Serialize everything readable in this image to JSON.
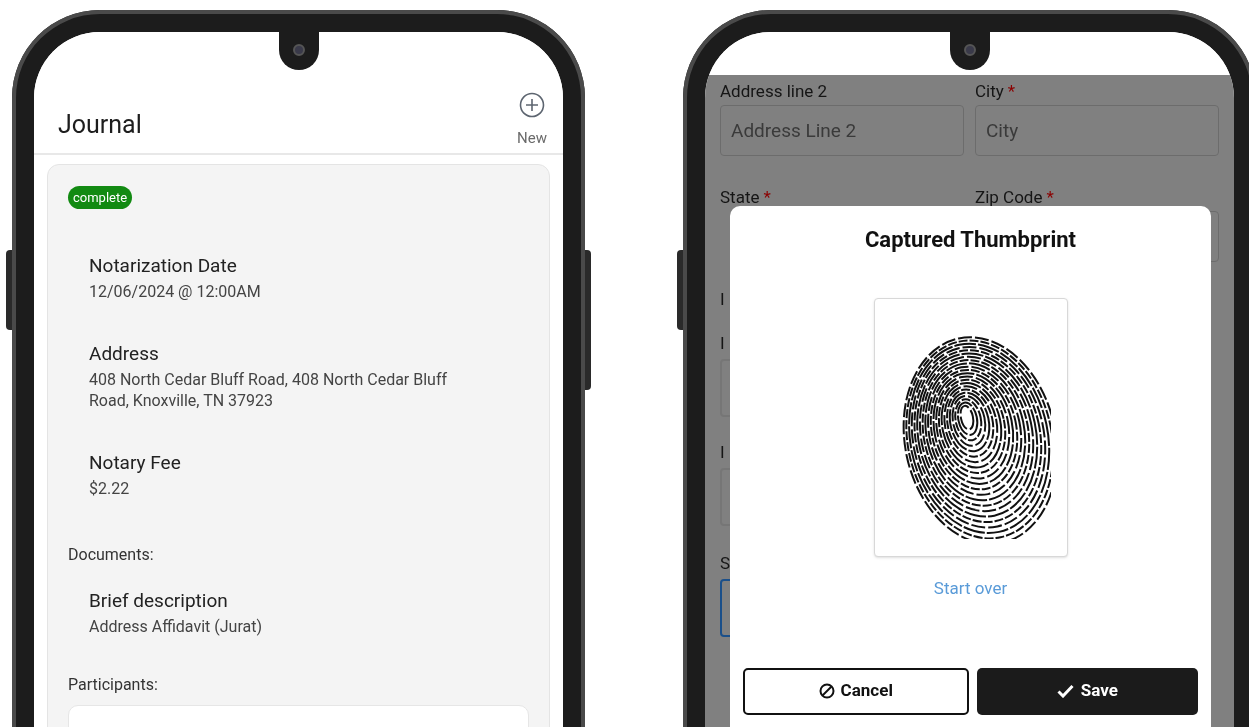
{
  "journal_screen": {
    "title": "Journal",
    "new_button": {
      "label": "New"
    },
    "entry": {
      "status": "complete",
      "fields": [
        {
          "label": "Notarization Date",
          "value": "12/06/2024 @ 12:00AM"
        },
        {
          "label": "Address",
          "value": "408 North Cedar Bluff Road, 408 North Cedar Bluff Road, Knoxville, TN 37923"
        },
        {
          "label": "Notary Fee",
          "value": "$2.22"
        }
      ],
      "documents_heading": "Documents:",
      "documents": [
        {
          "label": "Brief description",
          "value": "Address Affidavit (Jurat)"
        }
      ],
      "participants_heading": "Participants:"
    }
  },
  "thumbprint_screen": {
    "form_rows": [
      {
        "left": {
          "label": "Address line 2",
          "placeholder": "Address Line 2"
        },
        "right": {
          "label": "City",
          "required_mark": "*",
          "placeholder": "City"
        }
      },
      {
        "left": {
          "label": "State",
          "required_mark": "*"
        },
        "right": {
          "label": "Zip Code",
          "required_mark": "*"
        }
      },
      {
        "left": {
          "label": "I"
        }
      },
      {
        "left": {
          "label": "I"
        }
      },
      {
        "left": {
          "label": "I"
        }
      },
      {
        "left": {
          "label": "S",
          "focused": true
        }
      }
    ],
    "dialog": {
      "title": "Captured Thumbprint",
      "start_over": "Start over",
      "cancel": "Cancel",
      "save": "Save"
    }
  }
}
